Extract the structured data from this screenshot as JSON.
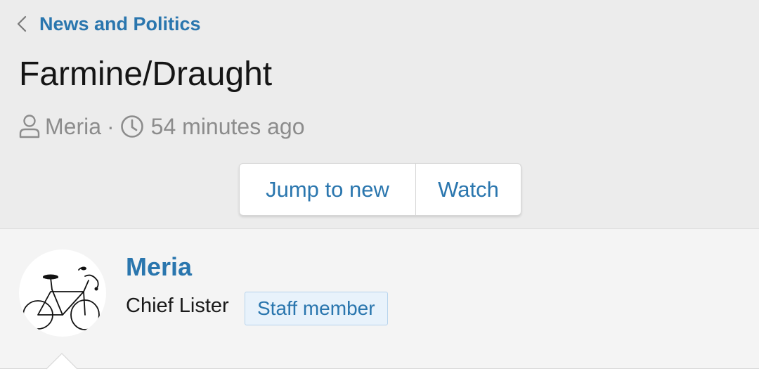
{
  "breadcrumb": {
    "back_icon": "chevron-left-icon",
    "label": "News and Politics"
  },
  "thread": {
    "title": "Farmine/Draught",
    "author": "Meria",
    "separator": "·",
    "time": "54 minutes ago",
    "author_icon": "user-icon",
    "time_icon": "clock-icon"
  },
  "actions": {
    "jump_to_new": "Jump to new",
    "watch": "Watch"
  },
  "post": {
    "user_name": "Meria",
    "user_title": "Chief Lister",
    "badge": "Staff member",
    "avatar_icon": "bicycle-icon"
  },
  "colors": {
    "accent": "#2a76ae",
    "header_bg": "#ececec",
    "post_bg": "#f4f4f4",
    "badge_bg": "#e8f2fb",
    "muted_text": "#8c8c8c"
  }
}
